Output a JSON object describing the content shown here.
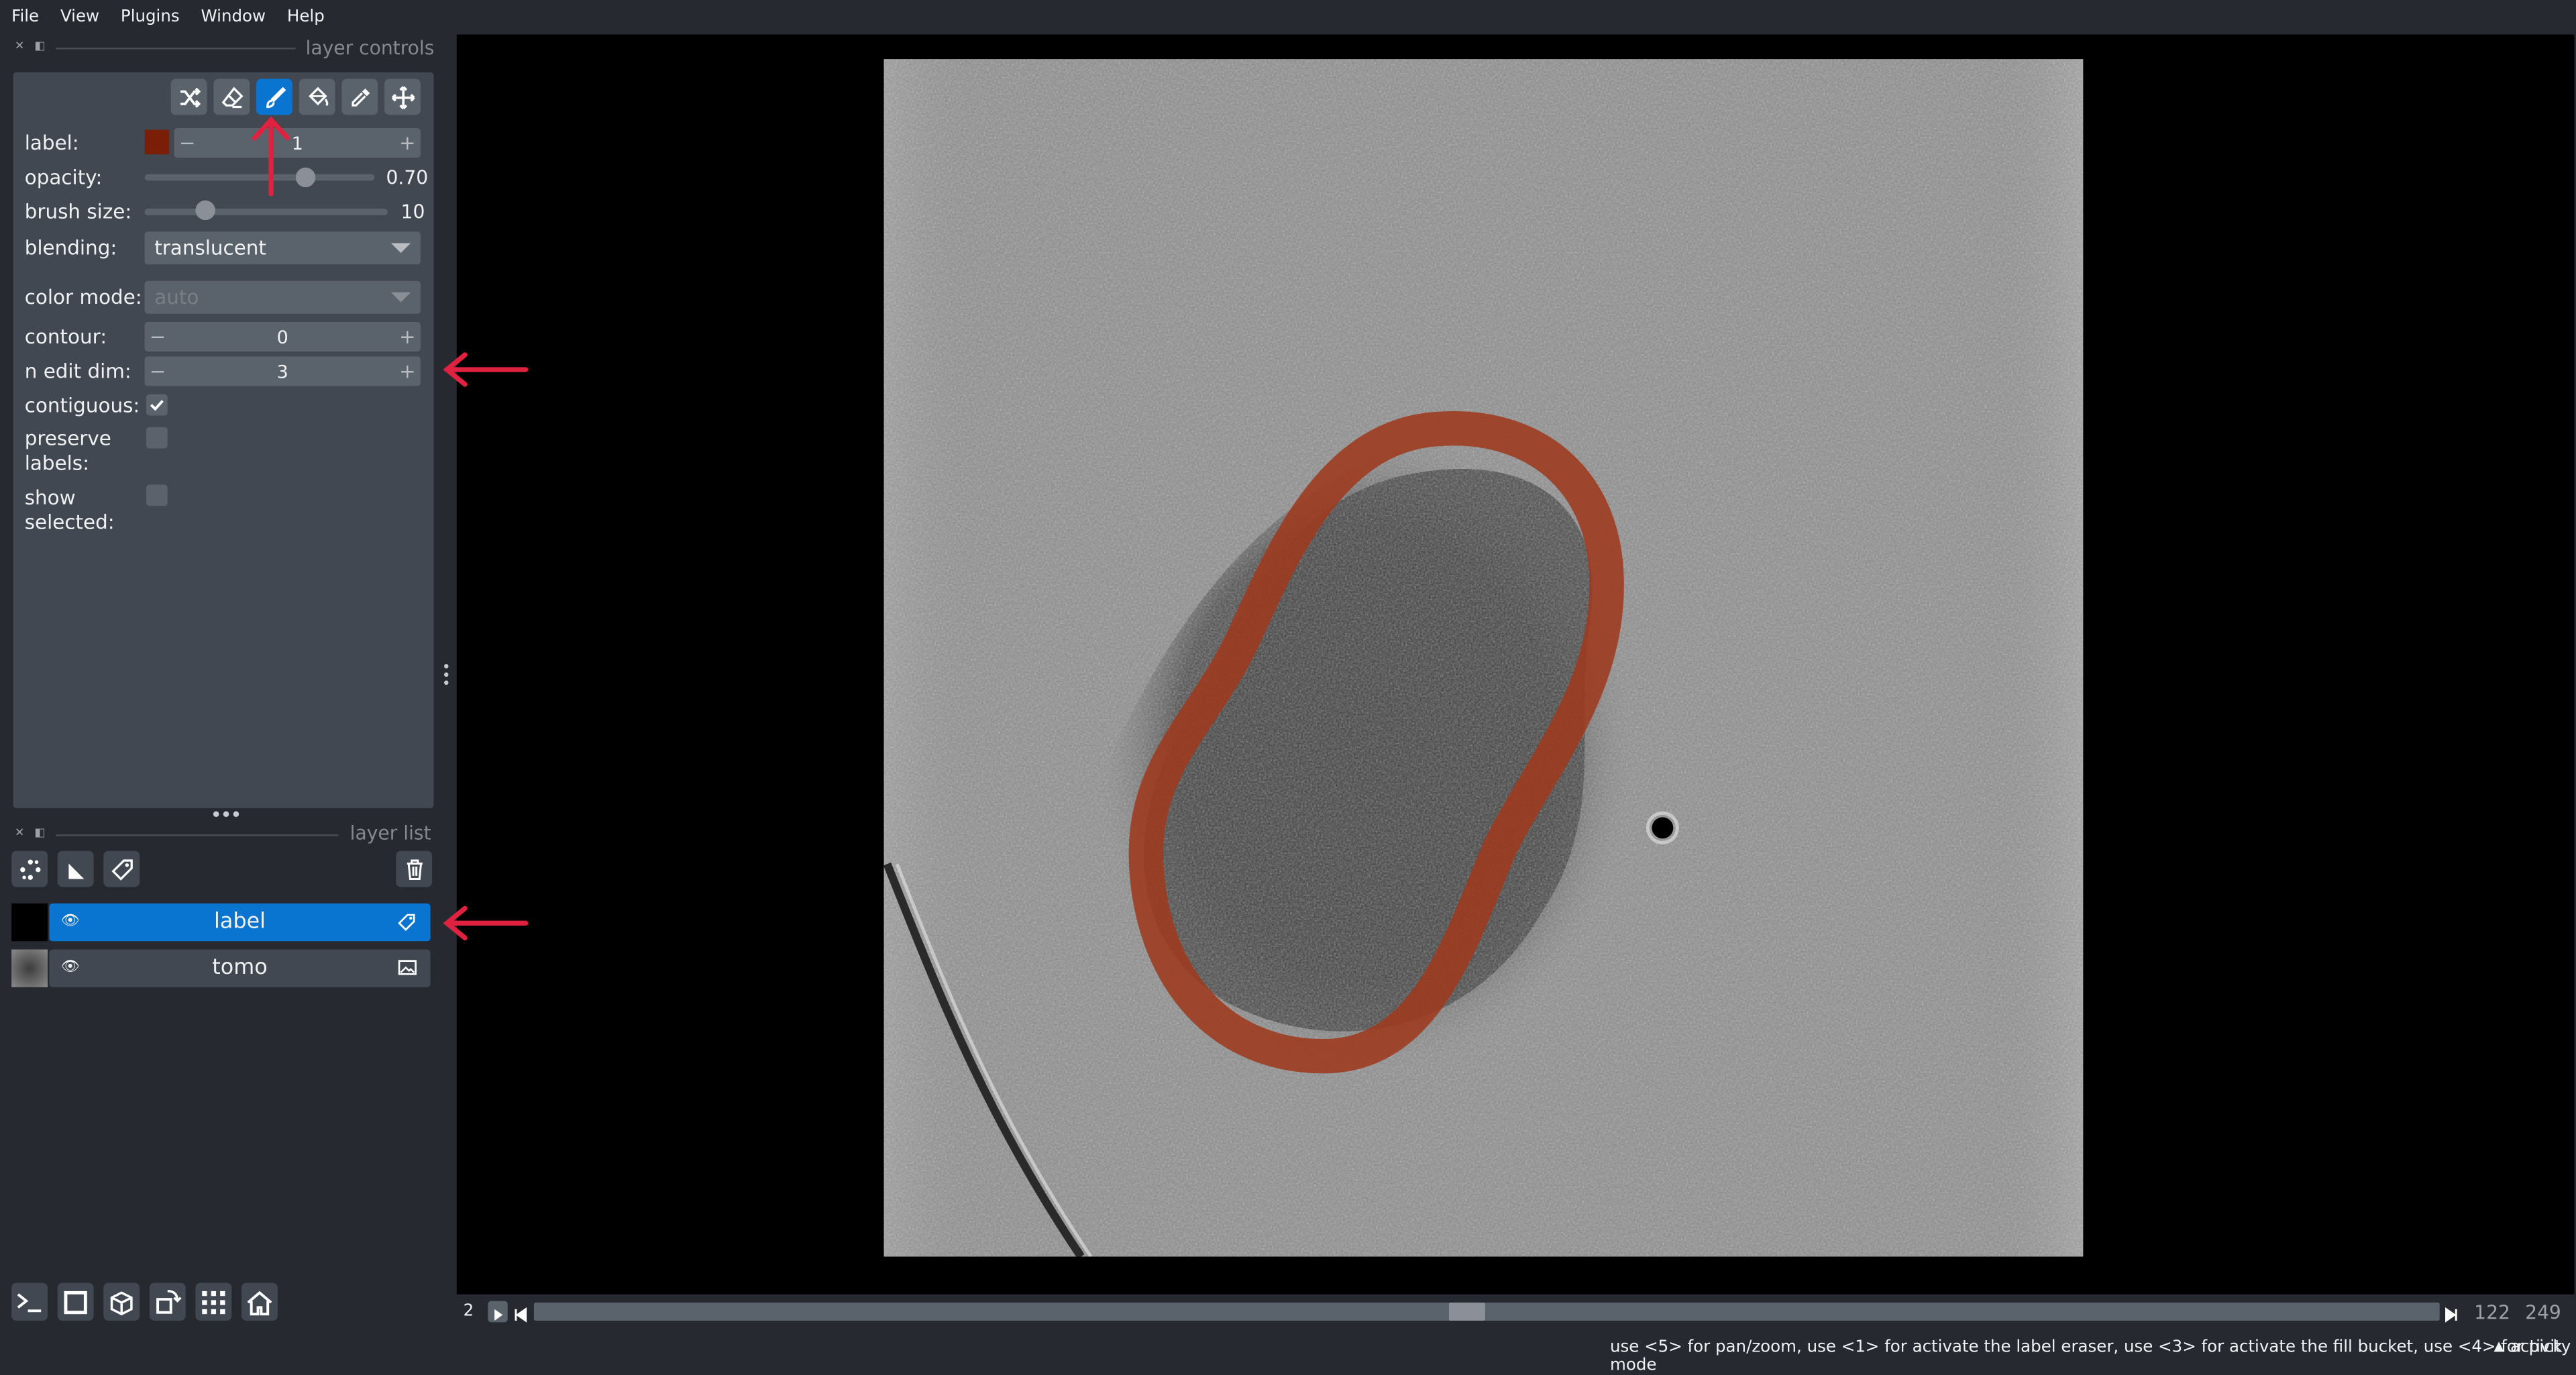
{
  "menu": [
    "File",
    "View",
    "Plugins",
    "Window",
    "Help"
  ],
  "layer_controls": {
    "title": "layer controls",
    "tools": [
      "shuffle-icon",
      "eraser-icon",
      "paintbrush-icon",
      "fill-bucket-icon",
      "color-picker-icon",
      "pan-zoom-icon"
    ],
    "active_tool": "paintbrush-icon",
    "label_label": "label:",
    "label_value": "1",
    "label_color": "#7a1e08",
    "opacity_label": "opacity:",
    "opacity_value": "0.70",
    "opacity_fraction": 0.7,
    "brush_size_label": "brush size:",
    "brush_size_value": "10",
    "blending_label": "blending:",
    "blending_value": "translucent",
    "color_mode_label": "color mode:",
    "color_mode_value": "auto",
    "contour_label": "contour:",
    "contour_value": "0",
    "n_edit_dim_label": "n edit dim:",
    "n_edit_dim_value": "3",
    "contiguous_label": "contiguous:",
    "contiguous_checked": true,
    "preserve_labels_label_1": "preserve",
    "preserve_labels_label_2": "labels:",
    "preserve_labels_checked": false,
    "show_selected_label_1": "show",
    "show_selected_label_2": "selected:",
    "show_selected_checked": false
  },
  "layer_list": {
    "title": "layer list",
    "buttons": [
      "new-points-icon",
      "new-shapes-icon",
      "new-labels-icon",
      "delete-layer-icon"
    ],
    "layers": [
      {
        "name": "label",
        "type": "labels",
        "selected": true,
        "visible": true
      },
      {
        "name": "tomo",
        "type": "image",
        "selected": false,
        "visible": true
      }
    ]
  },
  "bottom_buttons": [
    "console-icon",
    "2d-3d-toggle-icon",
    "roll-dims-icon",
    "transpose-icon",
    "grid-icon",
    "home-icon"
  ],
  "dims": {
    "axis": "2",
    "current": "122",
    "total": "249",
    "fraction": 0.49
  },
  "status": {
    "hint": "use <5> for pan/zoom, use <1> for activate the label eraser, use <3> for activate the fill bucket, use <4> for pick mode",
    "activity": "activity"
  },
  "colors": {
    "accent": "#0a74d1",
    "annotation_red": "#e0213f",
    "label_overlay": "#a0381c"
  }
}
